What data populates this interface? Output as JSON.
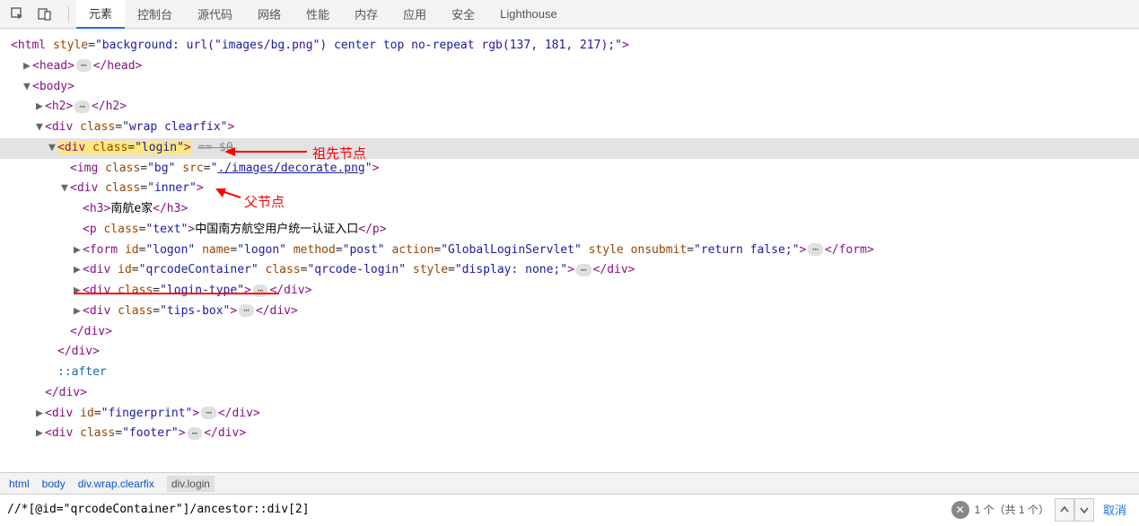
{
  "toolbar": {
    "tabs": [
      "元素",
      "控制台",
      "源代码",
      "网络",
      "性能",
      "内存",
      "应用",
      "安全",
      "Lighthouse"
    ],
    "active_tab": "元素"
  },
  "dom": {
    "html_open": "<html style=\"background: url(\"images/bg.png\") center top no-repeat rgb(137, 181, 217);\">",
    "head_open": "<head>",
    "head_close": "</head>",
    "body_open": "<body>",
    "h2_open": "<h2>",
    "h2_close": "</h2>",
    "wrap_open": "<div class=\"wrap clearfix\">",
    "login_open": "<div class=\"login\">",
    "login_strike": "== $0",
    "img_bg": "<img class=\"bg\" src=\"./images/decorate.png\">",
    "img_src_text": "./images/decorate.png",
    "inner_open": "<div class=\"inner\">",
    "h3_open": "<h3>",
    "h3_text": "南航e家",
    "h3_close": "</h3>",
    "p_open": "<p class=\"text\">",
    "p_text": "中国南方航空用户统一认证入口",
    "p_close": "</p>",
    "form_open": "<form id=\"logon\" name=\"logon\" method=\"post\" action=\"GlobalLoginServlet\" style onsubmit=\"return false;\">",
    "form_close": "</form>",
    "qrcode_open": "<div id=\"qrcodeContainer\" class=\"qrcode-login\" style=\"display: none;\">",
    "qrcode_close": "</div>",
    "login_type_open": "<div class=\"login-type\">",
    "login_type_close": "</div>",
    "tips_open": "<div class=\"tips-box\">",
    "tips_close": "</div>",
    "div_close": "</div>",
    "pseudo_after": "::after",
    "fingerprint_open": "<div id=\"fingerprint\">",
    "fingerprint_close": "</div>",
    "footer_open": "<div class=\"footer\">",
    "footer_close": "</div>"
  },
  "annotations": {
    "ancestor": "祖先节点",
    "parent": "父节点"
  },
  "breadcrumb": {
    "items": [
      "html",
      "body",
      "div.wrap.clearfix",
      "div.login"
    ]
  },
  "search": {
    "query": "//*[@id=\"qrcodeContainer\"]/ancestor::div[2]",
    "result": "1 个（共 1 个）",
    "cancel": "取消"
  }
}
